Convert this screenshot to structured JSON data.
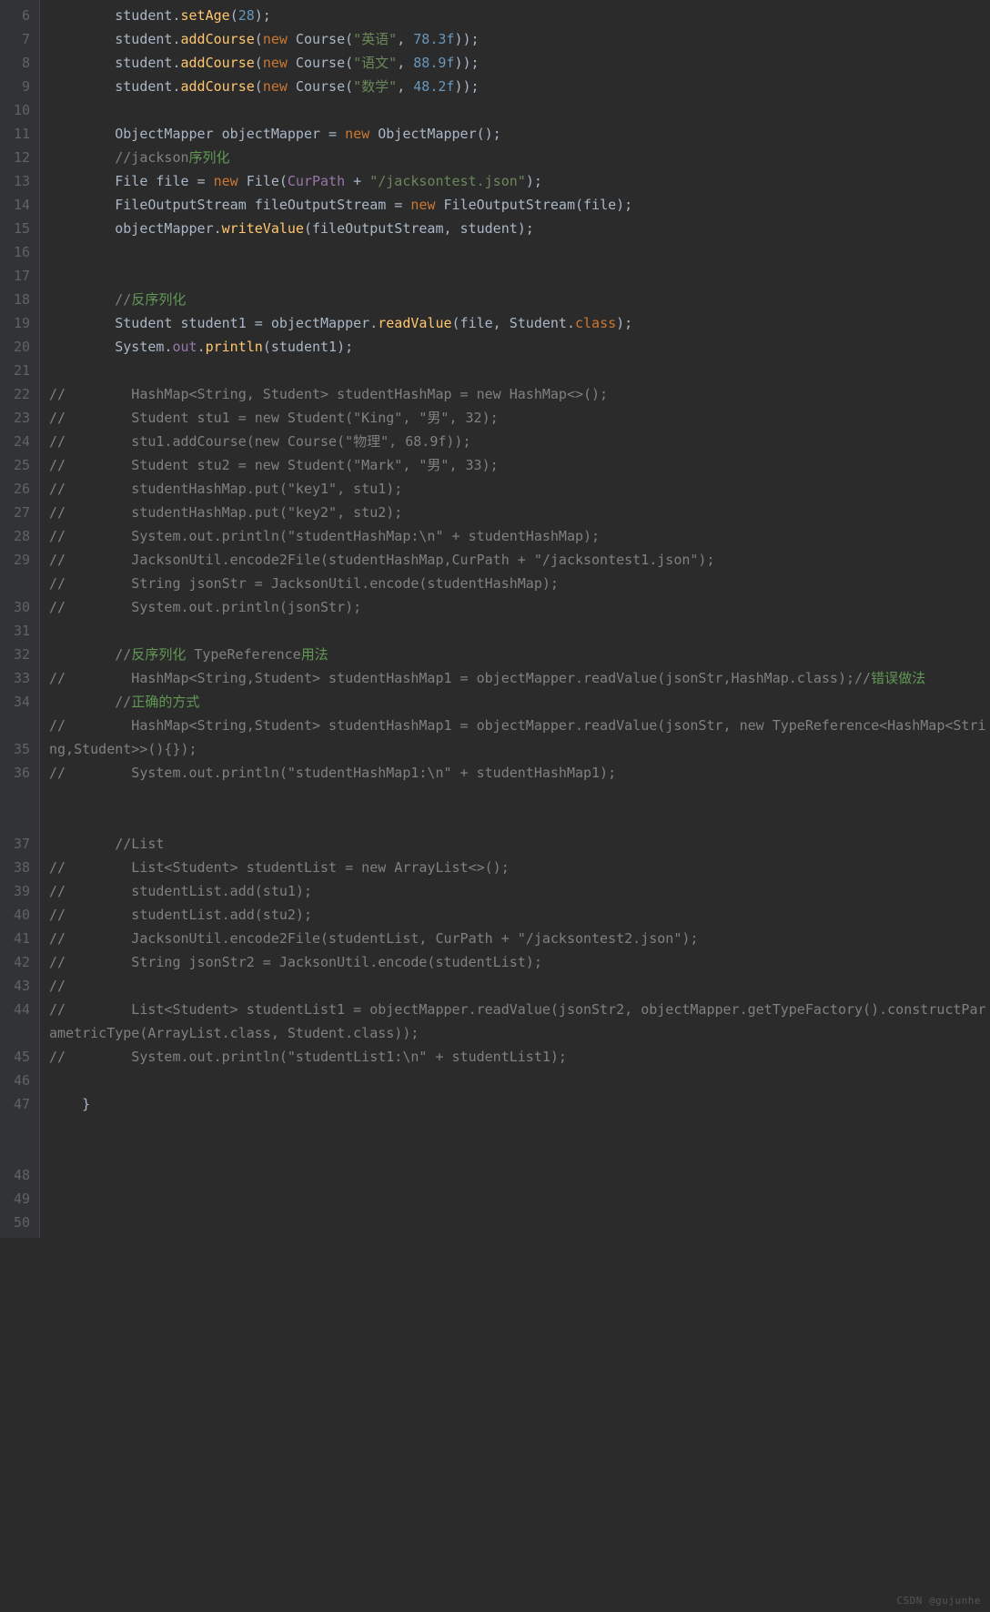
{
  "watermark": "CSDN @gujunhe",
  "lines": [
    {
      "num": "6",
      "tokens": [
        {
          "t": "        student.",
          "c": ""
        },
        {
          "t": "setAge",
          "c": "method"
        },
        {
          "t": "(",
          "c": ""
        },
        {
          "t": "28",
          "c": "num"
        },
        {
          "t": ");",
          "c": ""
        }
      ]
    },
    {
      "num": "7",
      "tokens": [
        {
          "t": "        student.",
          "c": ""
        },
        {
          "t": "addCourse",
          "c": "method"
        },
        {
          "t": "(",
          "c": ""
        },
        {
          "t": "new",
          "c": "kw"
        },
        {
          "t": " Course(",
          "c": ""
        },
        {
          "t": "\"英语\"",
          "c": "str"
        },
        {
          "t": ", ",
          "c": ""
        },
        {
          "t": "78.3f",
          "c": "num"
        },
        {
          "t": "));",
          "c": ""
        }
      ]
    },
    {
      "num": "8",
      "tokens": [
        {
          "t": "        student.",
          "c": ""
        },
        {
          "t": "addCourse",
          "c": "method"
        },
        {
          "t": "(",
          "c": ""
        },
        {
          "t": "new",
          "c": "kw"
        },
        {
          "t": " Course(",
          "c": ""
        },
        {
          "t": "\"语文\"",
          "c": "str"
        },
        {
          "t": ", ",
          "c": ""
        },
        {
          "t": "88.9f",
          "c": "num"
        },
        {
          "t": "));",
          "c": ""
        }
      ]
    },
    {
      "num": "9",
      "tokens": [
        {
          "t": "        student.",
          "c": ""
        },
        {
          "t": "addCourse",
          "c": "method"
        },
        {
          "t": "(",
          "c": ""
        },
        {
          "t": "new",
          "c": "kw"
        },
        {
          "t": " Course(",
          "c": ""
        },
        {
          "t": "\"数学\"",
          "c": "str"
        },
        {
          "t": ", ",
          "c": ""
        },
        {
          "t": "48.2f",
          "c": "num"
        },
        {
          "t": "));",
          "c": ""
        }
      ]
    },
    {
      "num": "10",
      "tokens": [
        {
          "t": "",
          "c": ""
        }
      ]
    },
    {
      "num": "11",
      "tokens": [
        {
          "t": "        ObjectMapper objectMapper = ",
          "c": ""
        },
        {
          "t": "new",
          "c": "kw"
        },
        {
          "t": " ObjectMapper();",
          "c": ""
        }
      ]
    },
    {
      "num": "12",
      "tokens": [
        {
          "t": "        ",
          "c": ""
        },
        {
          "t": "//jackson",
          "c": "cmt"
        },
        {
          "t": "序列化",
          "c": "cmt-cn"
        }
      ]
    },
    {
      "num": "13",
      "tokens": [
        {
          "t": "        File file = ",
          "c": ""
        },
        {
          "t": "new",
          "c": "kw"
        },
        {
          "t": " File(",
          "c": ""
        },
        {
          "t": "CurPath",
          "c": "field"
        },
        {
          "t": " + ",
          "c": ""
        },
        {
          "t": "\"/jacksontest.json\"",
          "c": "str"
        },
        {
          "t": ");",
          "c": ""
        }
      ]
    },
    {
      "num": "14",
      "tokens": [
        {
          "t": "        FileOutputStream fileOutputStream = ",
          "c": ""
        },
        {
          "t": "new",
          "c": "kw"
        },
        {
          "t": " FileOutputStream(file);",
          "c": ""
        }
      ]
    },
    {
      "num": "15",
      "tokens": [
        {
          "t": "        objectMapper.",
          "c": ""
        },
        {
          "t": "writeValue",
          "c": "method"
        },
        {
          "t": "(fileOutputStream, student);",
          "c": ""
        }
      ]
    },
    {
      "num": "16",
      "tokens": [
        {
          "t": "",
          "c": ""
        }
      ]
    },
    {
      "num": "17",
      "tokens": [
        {
          "t": "",
          "c": ""
        }
      ]
    },
    {
      "num": "18",
      "tokens": [
        {
          "t": "        ",
          "c": ""
        },
        {
          "t": "//",
          "c": "cmt"
        },
        {
          "t": "反序列化",
          "c": "cmt-cn"
        }
      ]
    },
    {
      "num": "19",
      "tokens": [
        {
          "t": "        Student student1 = objectMapper.",
          "c": ""
        },
        {
          "t": "readValue",
          "c": "method"
        },
        {
          "t": "(file, Student.",
          "c": ""
        },
        {
          "t": "class",
          "c": "kw"
        },
        {
          "t": ");",
          "c": ""
        }
      ]
    },
    {
      "num": "20",
      "tokens": [
        {
          "t": "        System.",
          "c": ""
        },
        {
          "t": "out",
          "c": "field"
        },
        {
          "t": ".",
          "c": ""
        },
        {
          "t": "println",
          "c": "method"
        },
        {
          "t": "(student1);",
          "c": ""
        }
      ]
    },
    {
      "num": "21",
      "tokens": [
        {
          "t": "",
          "c": ""
        }
      ]
    },
    {
      "num": "22",
      "tokens": [
        {
          "t": "//        HashMap<String, Student> studentHashMap = new HashMap<>();",
          "c": "cmt"
        }
      ]
    },
    {
      "num": "23",
      "tokens": [
        {
          "t": "//        Student stu1 = new Student(\"King\", \"男\", 32);",
          "c": "cmt"
        }
      ]
    },
    {
      "num": "24",
      "tokens": [
        {
          "t": "//        stu1.addCourse(new Course(\"物理\", 68.9f));",
          "c": "cmt"
        }
      ]
    },
    {
      "num": "25",
      "tokens": [
        {
          "t": "//        Student stu2 = new Student(\"Mark\", \"男\", 33);",
          "c": "cmt"
        }
      ]
    },
    {
      "num": "26",
      "tokens": [
        {
          "t": "//        studentHashMap.put(\"key1\", stu1);",
          "c": "cmt"
        }
      ]
    },
    {
      "num": "27",
      "tokens": [
        {
          "t": "//        studentHashMap.put(\"key2\", stu2);",
          "c": "cmt"
        }
      ]
    },
    {
      "num": "28",
      "tokens": [
        {
          "t": "//        System.out.println(\"studentHashMap:\\n\" + studentHashMap);",
          "c": "cmt"
        }
      ]
    },
    {
      "num": "29",
      "wrap": true,
      "tokens": [
        {
          "t": "//        JacksonUtil.encode2File(studentHashMap,CurPath + \"/jacksontest1.json\");",
          "c": "cmt"
        }
      ],
      "extraRows": 1
    },
    {
      "num": "30",
      "tokens": [
        {
          "t": "//        String jsonStr = JacksonUtil.encode(studentHashMap);",
          "c": "cmt"
        }
      ]
    },
    {
      "num": "31",
      "tokens": [
        {
          "t": "//        System.out.println(jsonStr);",
          "c": "cmt"
        }
      ]
    },
    {
      "num": "32",
      "tokens": [
        {
          "t": "",
          "c": ""
        }
      ]
    },
    {
      "num": "33",
      "tokens": [
        {
          "t": "        ",
          "c": ""
        },
        {
          "t": "//",
          "c": "cmt"
        },
        {
          "t": "反序列化 ",
          "c": "cmt-cn"
        },
        {
          "t": "TypeReference",
          "c": "cmt"
        },
        {
          "t": "用法",
          "c": "cmt-cn"
        }
      ]
    },
    {
      "num": "34",
      "wrap": true,
      "tokens": [
        {
          "t": "//        HashMap<String,Student> studentHashMap1 = objectMapper.readValue(jsonStr,HashMap.class);",
          "c": "cmt"
        },
        {
          "t": "//",
          "c": "cmt"
        },
        {
          "t": "错误做法",
          "c": "cmt-cn"
        }
      ],
      "extraRows": 1
    },
    {
      "num": "35",
      "tokens": [
        {
          "t": "        ",
          "c": ""
        },
        {
          "t": "//",
          "c": "cmt"
        },
        {
          "t": "正确的方式",
          "c": "cmt-cn"
        }
      ]
    },
    {
      "num": "36",
      "wrap": true,
      "tokens": [
        {
          "t": "//        HashMap<String,Student> studentHashMap1 = objectMapper.readValue(jsonStr, new TypeReference<HashMap<String,Student>>(){});",
          "c": "cmt"
        }
      ],
      "extraRows": 2
    },
    {
      "num": "37",
      "tokens": [
        {
          "t": "//        System.out.println(\"studentHashMap1:\\n\" + studentHashMap1);",
          "c": "cmt"
        }
      ]
    },
    {
      "num": "38",
      "tokens": [
        {
          "t": "",
          "c": ""
        }
      ]
    },
    {
      "num": "39",
      "tokens": [
        {
          "t": "",
          "c": ""
        }
      ]
    },
    {
      "num": "40",
      "tokens": [
        {
          "t": "        ",
          "c": ""
        },
        {
          "t": "//List",
          "c": "cmt"
        }
      ]
    },
    {
      "num": "41",
      "tokens": [
        {
          "t": "//        List<Student> studentList = new ArrayList<>();",
          "c": "cmt"
        }
      ]
    },
    {
      "num": "42",
      "tokens": [
        {
          "t": "//        studentList.add(stu1);",
          "c": "cmt"
        }
      ]
    },
    {
      "num": "43",
      "tokens": [
        {
          "t": "//        studentList.add(stu2);",
          "c": "cmt"
        }
      ]
    },
    {
      "num": "44",
      "wrap": true,
      "tokens": [
        {
          "t": "//        JacksonUtil.encode2File(studentList, CurPath + \"/jacksontest2.json\");",
          "c": "cmt"
        }
      ],
      "extraRows": 1
    },
    {
      "num": "45",
      "tokens": [
        {
          "t": "//        String jsonStr2 = JacksonUtil.encode(studentList);",
          "c": "cmt"
        }
      ]
    },
    {
      "num": "46",
      "tokens": [
        {
          "t": "//",
          "c": "cmt"
        }
      ]
    },
    {
      "num": "47",
      "wrap": true,
      "tokens": [
        {
          "t": "//        List<Student> studentList1 = objectMapper.readValue(jsonStr2, objectMapper.getTypeFactory().constructParametricType(ArrayList.class, Student.class));",
          "c": "cmt"
        }
      ],
      "extraRows": 2
    },
    {
      "num": "48",
      "tokens": [
        {
          "t": "//        System.out.println(\"studentList1:\\n\" + studentList1);",
          "c": "cmt"
        }
      ]
    },
    {
      "num": "49",
      "tokens": [
        {
          "t": "",
          "c": ""
        }
      ]
    },
    {
      "num": "50",
      "tokens": [
        {
          "t": "    }",
          "c": ""
        }
      ]
    }
  ]
}
